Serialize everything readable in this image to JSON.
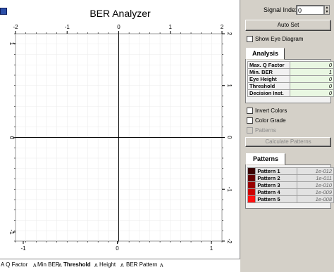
{
  "chart": {
    "title": "BER Analyzer",
    "x_top_ticks": [
      "-2",
      "-1",
      "0",
      "1",
      "2"
    ],
    "x_bottom_ticks": [
      "-1",
      "0",
      "1"
    ],
    "y_left_ticks": [
      "1",
      "0",
      "-1"
    ],
    "y_right_ticks": [
      "2",
      "1",
      "0",
      "-1",
      "-2"
    ]
  },
  "bottom_tabs": [
    {
      "label": "A  Q Factor"
    },
    {
      "label": "Min BER"
    },
    {
      "label": "Threshold"
    },
    {
      "label": "Height"
    },
    {
      "label": "BER Pattern"
    }
  ],
  "signal_index": {
    "label": "Signal Index",
    "value": "0"
  },
  "auto_set_label": "Auto Set",
  "show_eye_diagram_label": "Show Eye Diagram",
  "analysis": {
    "tab_label": "Analysis",
    "rows": [
      {
        "name": "Max. Q Factor",
        "value": "0"
      },
      {
        "name": "Min. BER",
        "value": "1"
      },
      {
        "name": "Eye Height",
        "value": "0"
      },
      {
        "name": "Threshold",
        "value": "0"
      },
      {
        "name": "Decision Inst.",
        "value": "0"
      }
    ]
  },
  "invert_colors_label": "Invert Colors",
  "color_grade_label": "Color Grade",
  "patterns_checkbox_label": "Patterns",
  "calculate_patterns_label": "Calculate Patterns",
  "patterns": {
    "tab_label": "Patterns",
    "rows": [
      {
        "name": "Pattern 1",
        "value": "1e-012",
        "color": "#3a0000"
      },
      {
        "name": "Pattern 2",
        "value": "1e-011",
        "color": "#660000"
      },
      {
        "name": "Pattern 3",
        "value": "1e-010",
        "color": "#990000"
      },
      {
        "name": "Pattern 4",
        "value": "1e-009",
        "color": "#cc0000"
      },
      {
        "name": "Pattern 5",
        "value": "1e-008",
        "color": "#ff1010"
      }
    ]
  }
}
